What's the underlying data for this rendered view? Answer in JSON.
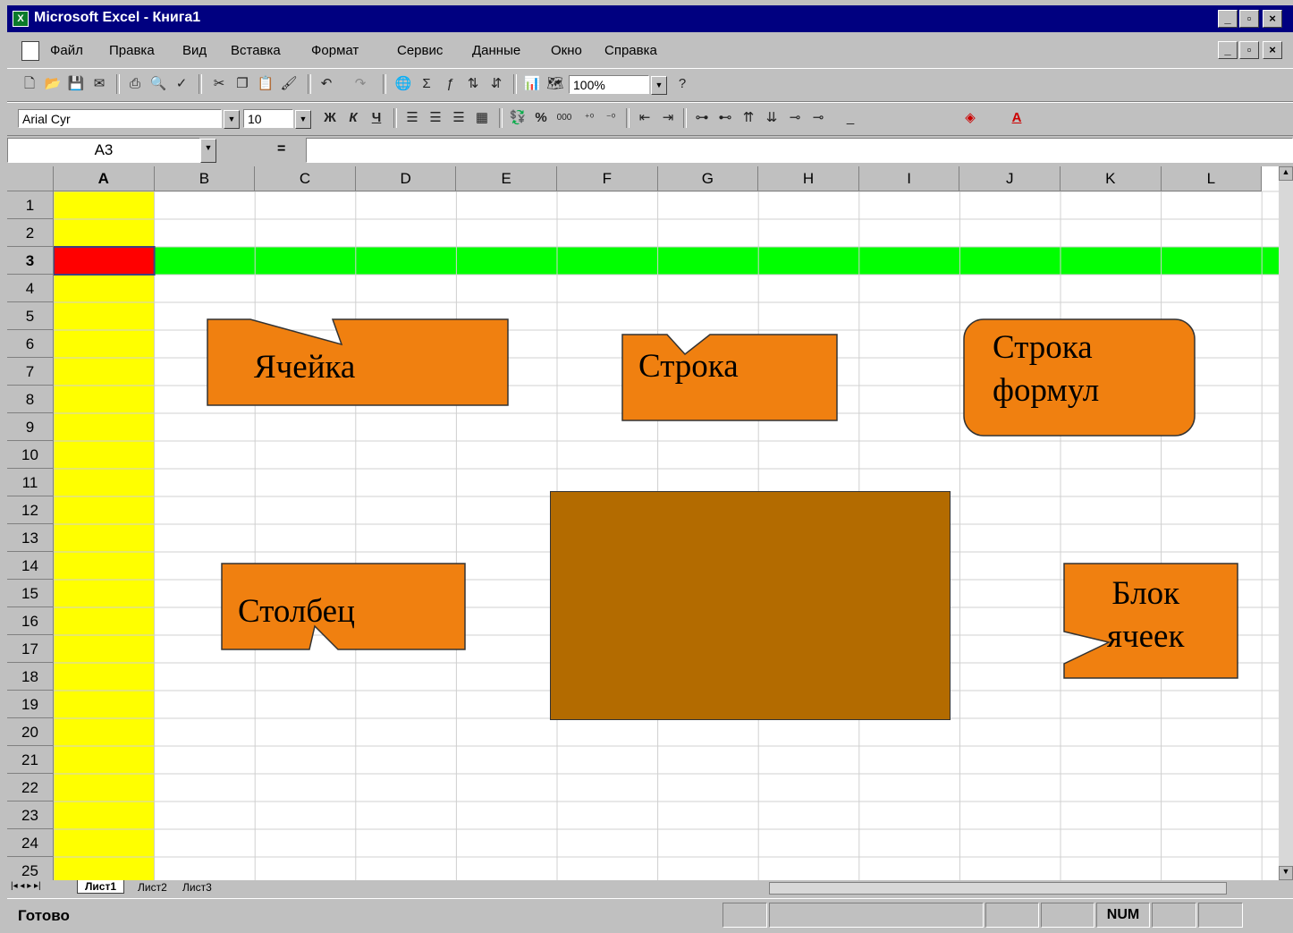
{
  "titlebar": {
    "icon": "excel-icon",
    "title": "Microsoft Excel - Книга1"
  },
  "menubar": {
    "items": [
      "Файл",
      "Правка",
      "Вид",
      "Вставка",
      "Формат",
      "Сервис",
      "Данные",
      "Окно",
      "Справка"
    ]
  },
  "standard_toolbar": {
    "icons": [
      "new-icon",
      "open-icon",
      "save-icon",
      "mail-icon",
      "print-icon",
      "print-preview-icon",
      "spelling-icon",
      "cut-icon",
      "copy-icon",
      "paste-icon",
      "format-painter-icon",
      "undo-icon",
      "redo-icon",
      "hyperlink-icon",
      "autosum-icon",
      "function-icon",
      "sort-asc-icon",
      "sort-desc-icon",
      "chart-wizard-icon",
      "map-icon",
      "help-icon"
    ],
    "zoom": "100%"
  },
  "formatting_toolbar": {
    "font": "Arial Cyr",
    "size": "10",
    "bold": "Ж",
    "italic": "К",
    "underline": "Ч",
    "icons": [
      "align-left-icon",
      "align-center-icon",
      "align-right-icon",
      "merge-center-icon",
      "currency-icon",
      "percent-icon",
      "comma-icon",
      "increase-decimal-icon",
      "decrease-decimal-icon",
      "decrease-indent-icon",
      "increase-indent-icon",
      "trace-precedents-icon",
      "trace-dependents-icon",
      "borders-icon",
      "fill-color-icon",
      "font-color-icon"
    ],
    "percent_label": "%",
    "thousands_label": "000"
  },
  "formula_bar": {
    "name_box": "A3",
    "equals": "=",
    "value": ""
  },
  "grid": {
    "columns": [
      "A",
      "B",
      "C",
      "D",
      "E",
      "F",
      "G",
      "H",
      "I",
      "J",
      "K",
      "L"
    ],
    "rows": [
      "1",
      "2",
      "3",
      "4",
      "5",
      "6",
      "7",
      "8",
      "9",
      "10",
      "11",
      "12",
      "13",
      "14",
      "15",
      "16",
      "17",
      "18",
      "19",
      "20",
      "21",
      "22",
      "23",
      "24",
      "25"
    ],
    "selected_cell": "A3",
    "colors": {
      "column_fill": "#ffff00",
      "row_fill": "#00ff00",
      "cell_fill": "#ff0000",
      "block_fill": "#b36b00",
      "callout_fill": "#f08010"
    }
  },
  "callouts": {
    "cell": "Ячейка",
    "row": "Строка",
    "formula_bar": "Строка\nформул",
    "column": "Столбец",
    "block": "Блок\nячеек"
  },
  "sheet_tabs": [
    "Лист1",
    "Лист2",
    "Лист3"
  ],
  "status": {
    "text": "Готово",
    "num": "NUM"
  }
}
